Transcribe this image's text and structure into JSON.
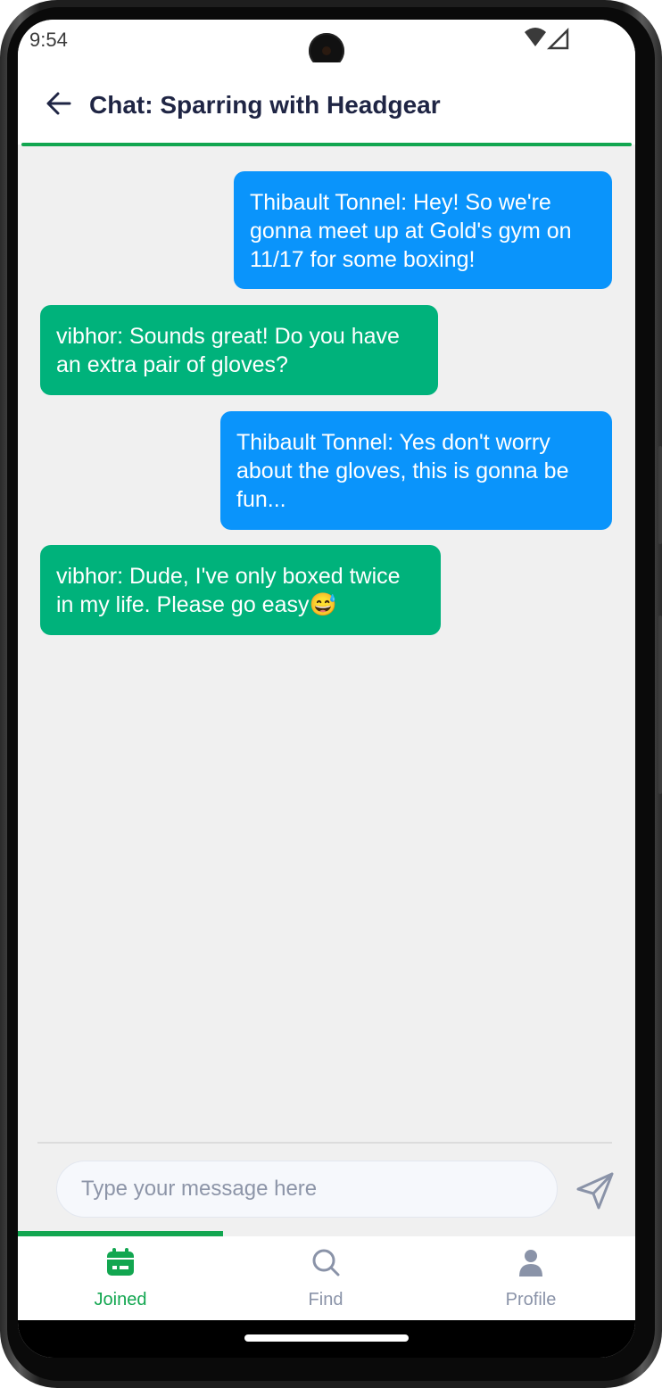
{
  "status_bar": {
    "time": "9:54"
  },
  "header": {
    "title": "Chat: Sparring with Headgear"
  },
  "messages": [
    {
      "direction": "outgoing",
      "lines": [
        "Thibault Tonnel: Hey! So we're",
        "gonna meet up at Gold's gym on",
        "11/17 for some boxing!"
      ]
    },
    {
      "direction": "incoming",
      "lines": [
        "vibhor: Sounds great! Do you have",
        "an extra pair of gloves?"
      ]
    },
    {
      "direction": "outgoing",
      "lines": [
        "Thibault Tonnel: Yes don't worry",
        "about the gloves, this is gonna be",
        "fun..."
      ]
    },
    {
      "direction": "incoming",
      "lines": [
        "vibhor: Dude, I've only boxed twice",
        "in my life. Please go easy😅"
      ]
    }
  ],
  "composer": {
    "placeholder": "Type your message here",
    "value": ""
  },
  "tabs": [
    {
      "label": "Joined",
      "icon": "calendar-icon",
      "active": true
    },
    {
      "label": "Find",
      "icon": "search-icon",
      "active": false
    },
    {
      "label": "Profile",
      "icon": "person-icon",
      "active": false
    }
  ],
  "colors": {
    "accent": "#12a650",
    "outgoing_bubble": "#0a94fb",
    "incoming_bubble": "#00b27b",
    "title_text": "#1f2544",
    "inactive_tab": "#8a93a8"
  }
}
